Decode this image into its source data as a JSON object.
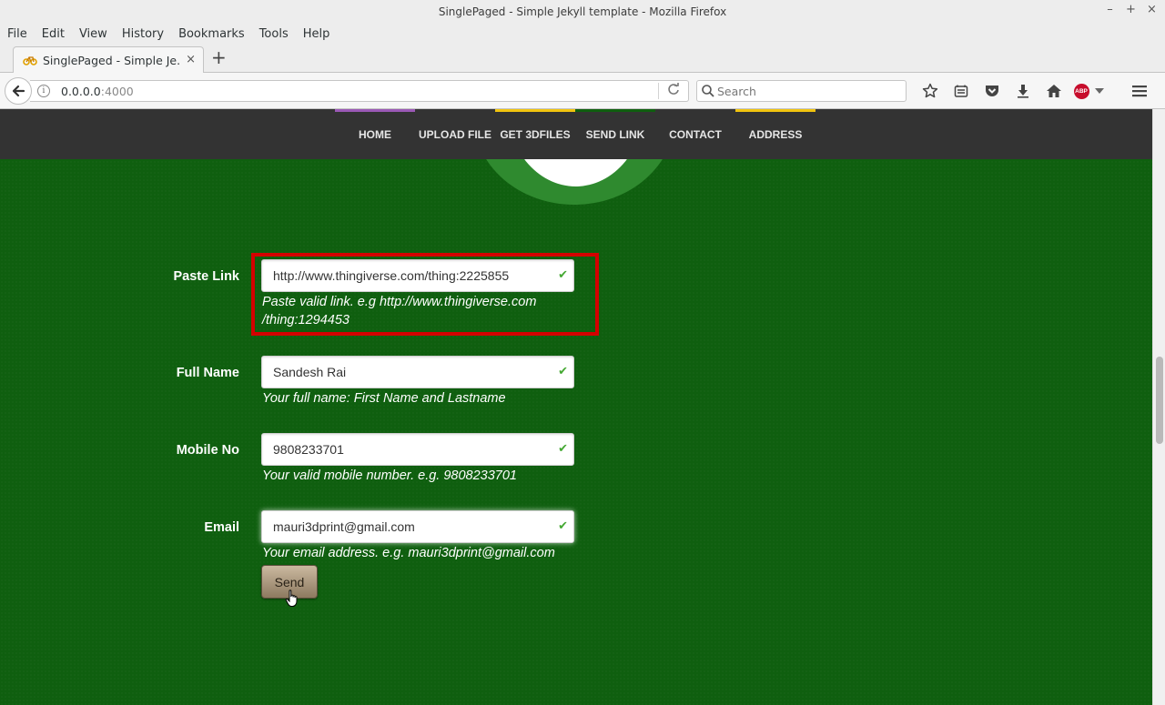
{
  "window": {
    "title": "SinglePaged - Simple Jekyll template - Mozilla Firefox",
    "controls": [
      "–",
      "+",
      "×"
    ]
  },
  "menubar": {
    "items": [
      "File",
      "Edit",
      "View",
      "History",
      "Bookmarks",
      "Tools",
      "Help"
    ]
  },
  "tabs": {
    "active_label": "SinglePaged - Simple Je...",
    "close_symbol": "×",
    "new_tab_symbol": "+"
  },
  "navbar": {
    "url_host": "0.0.0.0",
    "url_port": ":4000",
    "search_placeholder": "Search",
    "abp_label": "ABP"
  },
  "site_nav": {
    "items": [
      {
        "label": "HOME",
        "color": "#9b59b6"
      },
      {
        "label": "UPLOAD FILE",
        "color": "#333333"
      },
      {
        "label": "GET 3DFILES",
        "color": "#f1c40f"
      },
      {
        "label": "SEND LINK",
        "color": "#0f5f0f"
      },
      {
        "label": "CONTACT",
        "color": "#333333"
      },
      {
        "label": "ADDRESS",
        "color": "#f1c40f"
      }
    ]
  },
  "form": {
    "paste_link": {
      "label": "Paste Link",
      "value": "http://www.thingiverse.com/thing:2225855",
      "help_line1": "Paste valid link. e.g http://www.thingiverse.com",
      "help_line2": "/thing:1294453"
    },
    "full_name": {
      "label": "Full Name",
      "value": "Sandesh Rai",
      "help": "Your full name: First Name and Lastname"
    },
    "mobile": {
      "label": "Mobile No",
      "value": "9808233701",
      "help": "Your valid mobile number. e.g. 9808233701"
    },
    "email": {
      "label": "Email",
      "value": "mauri3dprint@gmail.com",
      "help": "Your email address. e.g. mauri3dprint@gmail.com"
    },
    "check_symbol": "✔",
    "send_label": "Send"
  },
  "colors": {
    "page_background": "#0f5f0f",
    "nav_background": "#333333",
    "highlight_border": "#d40000",
    "valid_check": "#44a832"
  }
}
